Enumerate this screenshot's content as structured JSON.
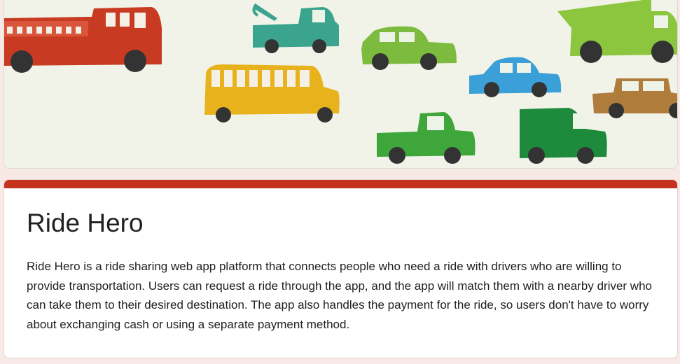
{
  "form": {
    "title": "Ride Hero",
    "description": "Ride Hero is a ride sharing web app platform that connects people who need a ride with drivers who are willing to provide transportation. Users can request a ride through the app, and the app will match them with a nearby driver who can take them to their desired destination. The app also handles the payment for the ride, so users don't have to worry about exchanging cash or using a separate payment method."
  },
  "theme": {
    "accent_color": "#c5321e",
    "page_background": "#f8e9e6",
    "banner_background": "#f1f3e8"
  },
  "banner": {
    "illustration": "watercolor-vehicles",
    "vehicles": [
      "fire-truck",
      "tow-truck",
      "car-green",
      "dump-truck",
      "school-bus",
      "car-blue",
      "car-brown",
      "pickup-truck",
      "delivery-truck"
    ]
  }
}
